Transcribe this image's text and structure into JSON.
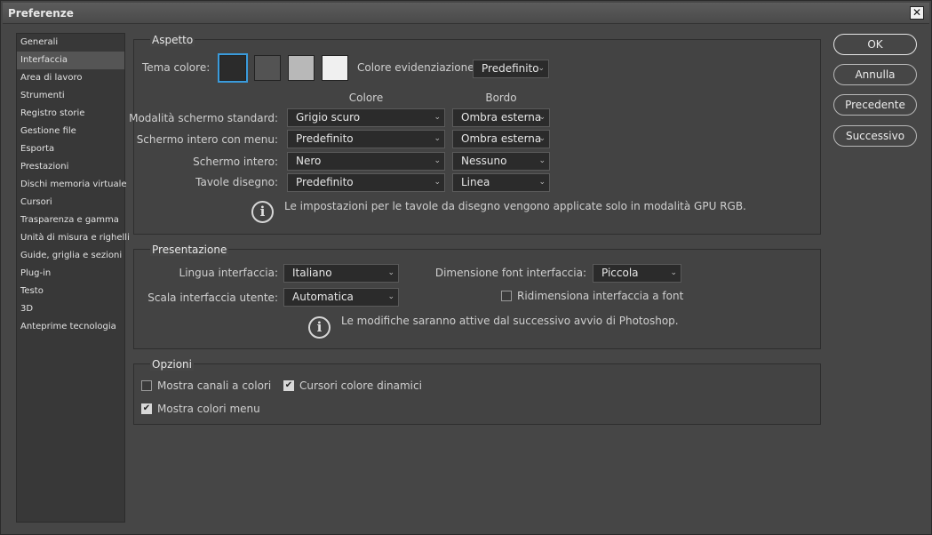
{
  "window": {
    "title": "Preferenze",
    "close_glyph": "✕"
  },
  "sidebar": {
    "items": [
      {
        "label": "Generali"
      },
      {
        "label": "Interfaccia"
      },
      {
        "label": "Area di lavoro"
      },
      {
        "label": "Strumenti"
      },
      {
        "label": "Registro storie"
      },
      {
        "label": "Gestione file"
      },
      {
        "label": "Esporta"
      },
      {
        "label": "Prestazioni"
      },
      {
        "label": "Dischi memoria virtuale"
      },
      {
        "label": "Cursori"
      },
      {
        "label": "Trasparenza e gamma"
      },
      {
        "label": "Unità di misura e righelli"
      },
      {
        "label": "Guide, griglia e sezioni"
      },
      {
        "label": "Plug-in"
      },
      {
        "label": "Testo"
      },
      {
        "label": "3D"
      },
      {
        "label": "Anteprime tecnologia"
      }
    ],
    "active_index": 1
  },
  "aspetto": {
    "title": "Aspetto",
    "tema_colore_label": "Tema colore:",
    "swatches": [
      "#2b2b2b",
      "#535353",
      "#b8b8b8",
      "#f0f0f0"
    ],
    "selected_swatch": 0,
    "colore_evidenziazione_label": "Colore evidenziazione:",
    "colore_evidenziazione_value": "Predefinito",
    "col_colore": "Colore",
    "col_bordo": "Bordo",
    "rows": [
      {
        "label": "Modalità schermo standard:",
        "colore": "Grigio scuro",
        "bordo": "Ombra esterna"
      },
      {
        "label": "Schermo intero con menu:",
        "colore": "Predefinito",
        "bordo": "Ombra esterna"
      },
      {
        "label": "Schermo intero:",
        "colore": "Nero",
        "bordo": "Nessuno"
      },
      {
        "label": "Tavole disegno:",
        "colore": "Predefinito",
        "bordo": "Linea"
      }
    ],
    "info": "Le impostazioni per le tavole da disegno vengono applicate solo in modalità GPU RGB."
  },
  "presentazione": {
    "title": "Presentazione",
    "lingua_label": "Lingua interfaccia:",
    "lingua_value": "Italiano",
    "font_label": "Dimensione font interfaccia:",
    "font_value": "Piccola",
    "scala_label": "Scala interfaccia utente:",
    "scala_value": "Automatica",
    "ridimensiona_label": "Ridimensiona interfaccia a font",
    "ridimensiona_checked": false,
    "info": "Le modifiche saranno attive dal successivo avvio di Photoshop."
  },
  "opzioni": {
    "title": "Opzioni",
    "mostra_canali": {
      "label": "Mostra canali a colori",
      "checked": false
    },
    "cursori_colore": {
      "label": "Cursori colore dinamici",
      "checked": true
    },
    "mostra_colori_menu": {
      "label": "Mostra colori menu",
      "checked": true
    }
  },
  "buttons": {
    "ok": "OK",
    "annulla": "Annulla",
    "precedente": "Precedente",
    "successivo": "Successivo"
  },
  "icons": {
    "info": "info-icon",
    "chevron": "chevron-down-icon",
    "check_glyph": "✔",
    "info_glyph": "i"
  }
}
